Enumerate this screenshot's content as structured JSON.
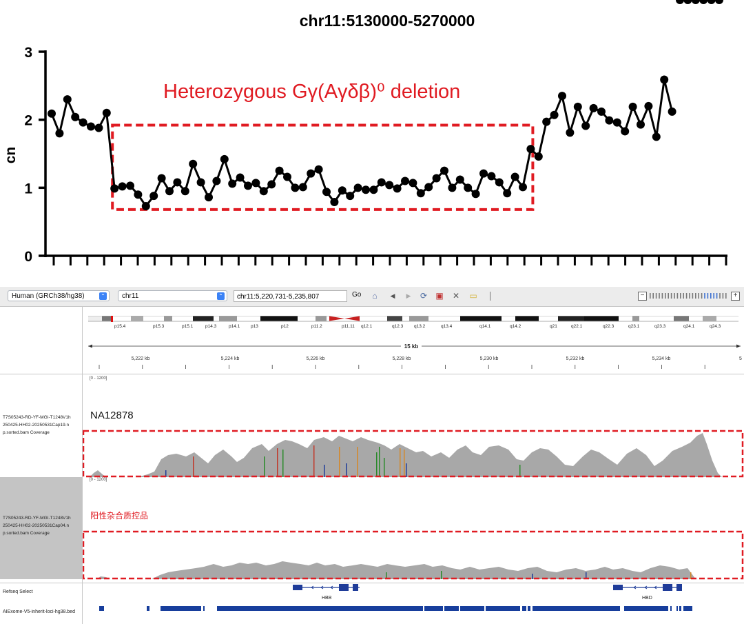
{
  "chart_data": {
    "type": "line",
    "title": "chr11:5130000-5270000",
    "ylabel": "cn",
    "xlabel": "",
    "ylim": [
      0,
      3
    ],
    "yticks": [
      0,
      1,
      2,
      3
    ],
    "grid": false,
    "annotation": "Heterozygous Gγ(Aγδβ)⁰  deletion",
    "x": [
      1,
      2,
      3,
      4,
      5,
      6,
      7,
      8,
      9,
      10,
      11,
      12,
      13,
      14,
      15,
      16,
      17,
      18,
      19,
      20,
      21,
      22,
      23,
      24,
      25,
      26,
      27,
      28,
      29,
      30,
      31,
      32,
      33,
      34,
      35,
      36,
      37,
      38,
      39,
      40,
      41,
      42,
      43,
      44,
      45,
      46,
      47,
      48,
      49,
      50,
      51,
      52,
      53,
      54,
      55,
      56,
      57,
      58,
      59,
      60,
      61,
      62,
      63,
      64,
      65,
      66,
      67,
      68,
      69,
      70,
      71,
      72,
      73,
      74,
      75,
      76,
      77,
      78,
      79,
      80,
      81,
      82,
      83,
      84,
      85,
      86
    ],
    "series": [
      {
        "name": "",
        "values": [
          2.09,
          1.8,
          2.3,
          2.04,
          1.96,
          1.9,
          1.88,
          2.1,
          0.99,
          1.02,
          1.03,
          0.9,
          0.73,
          0.88,
          1.14,
          0.95,
          1.08,
          0.95,
          1.35,
          1.08,
          0.86,
          1.1,
          1.42,
          1.06,
          1.15,
          1.03,
          1.07,
          0.95,
          1.05,
          1.25,
          1.16,
          1.0,
          1.01,
          1.21,
          1.27,
          0.94,
          0.79,
          0.96,
          0.88,
          1.0,
          0.97,
          0.97,
          1.08,
          1.04,
          0.99,
          1.1,
          1.07,
          0.92,
          1.01,
          1.14,
          1.25,
          1.0,
          1.12,
          1.0,
          0.91,
          1.21,
          1.17,
          1.08,
          0.92,
          1.16,
          1.01,
          1.57,
          1.46,
          1.97,
          2.07,
          2.35,
          1.81,
          2.19,
          1.91,
          2.17,
          2.12,
          1.99,
          1.96,
          1.83,
          2.19,
          1.93,
          2.2,
          1.75,
          2.59,
          2.12
        ]
      }
    ],
    "deletion_box": {
      "x_start": 9,
      "x_end": 62,
      "y_low": 0.68,
      "y_high": 1.92
    }
  },
  "colors": {
    "highlight": "#e01b22",
    "line": "#000000",
    "coverage": "#a8a8a8",
    "gene": "#1f3c99",
    "bed": "#173e9c"
  },
  "igv": {
    "genome_select": "Human (GRCh38/hg38)",
    "chrom_select": "chr11",
    "locus": "chr11:5,220,731-5,235,807",
    "go_label": "Go",
    "icons": [
      "home-icon",
      "back-icon",
      "forward-icon",
      "refresh-icon",
      "roi-icon",
      "close-icon",
      "popup-icon"
    ],
    "bands": [
      "p15.4",
      "p15.3",
      "p15.1",
      "p14.3",
      "p14.1",
      "p13",
      "p12",
      "p11.2",
      "p11.11",
      "q12.1",
      "q12.3",
      "q13.2",
      "q13.4",
      "q14.1",
      "q14.2",
      "q21",
      "q22.1",
      "q22.3",
      "q23.1",
      "q23.3",
      "q24.1",
      "q24.3"
    ],
    "span_label": "15 kb",
    "ruler_ticks": [
      "5,222 kb",
      "5,224 kb",
      "5,226 kb",
      "5,228 kb",
      "5,230 kb",
      "5,232 kb",
      "5,234 kb"
    ],
    "range_label": "[0 - 1200]",
    "tracks": [
      {
        "sample": "NA12878",
        "name_lines": [
          "T7S05243-RD-YF-MGI-T1248V1h",
          "250425-HH02-20250531Cap19.n",
          "p.sorted.bam Coverage"
        ]
      },
      {
        "sample": "阳性杂合质控品",
        "name_lines": [
          "T7S05243-RD-YF-MGI-T1248V1h",
          "250425-HH02-20250531Cap04.n",
          "p.sorted.bam Coverage"
        ]
      }
    ],
    "refseq_label": "Refseq Select",
    "genes": [
      "HBB",
      "HBD"
    ],
    "bed_label": "AIExome-V5-inherit-loci-hg38.bed"
  }
}
